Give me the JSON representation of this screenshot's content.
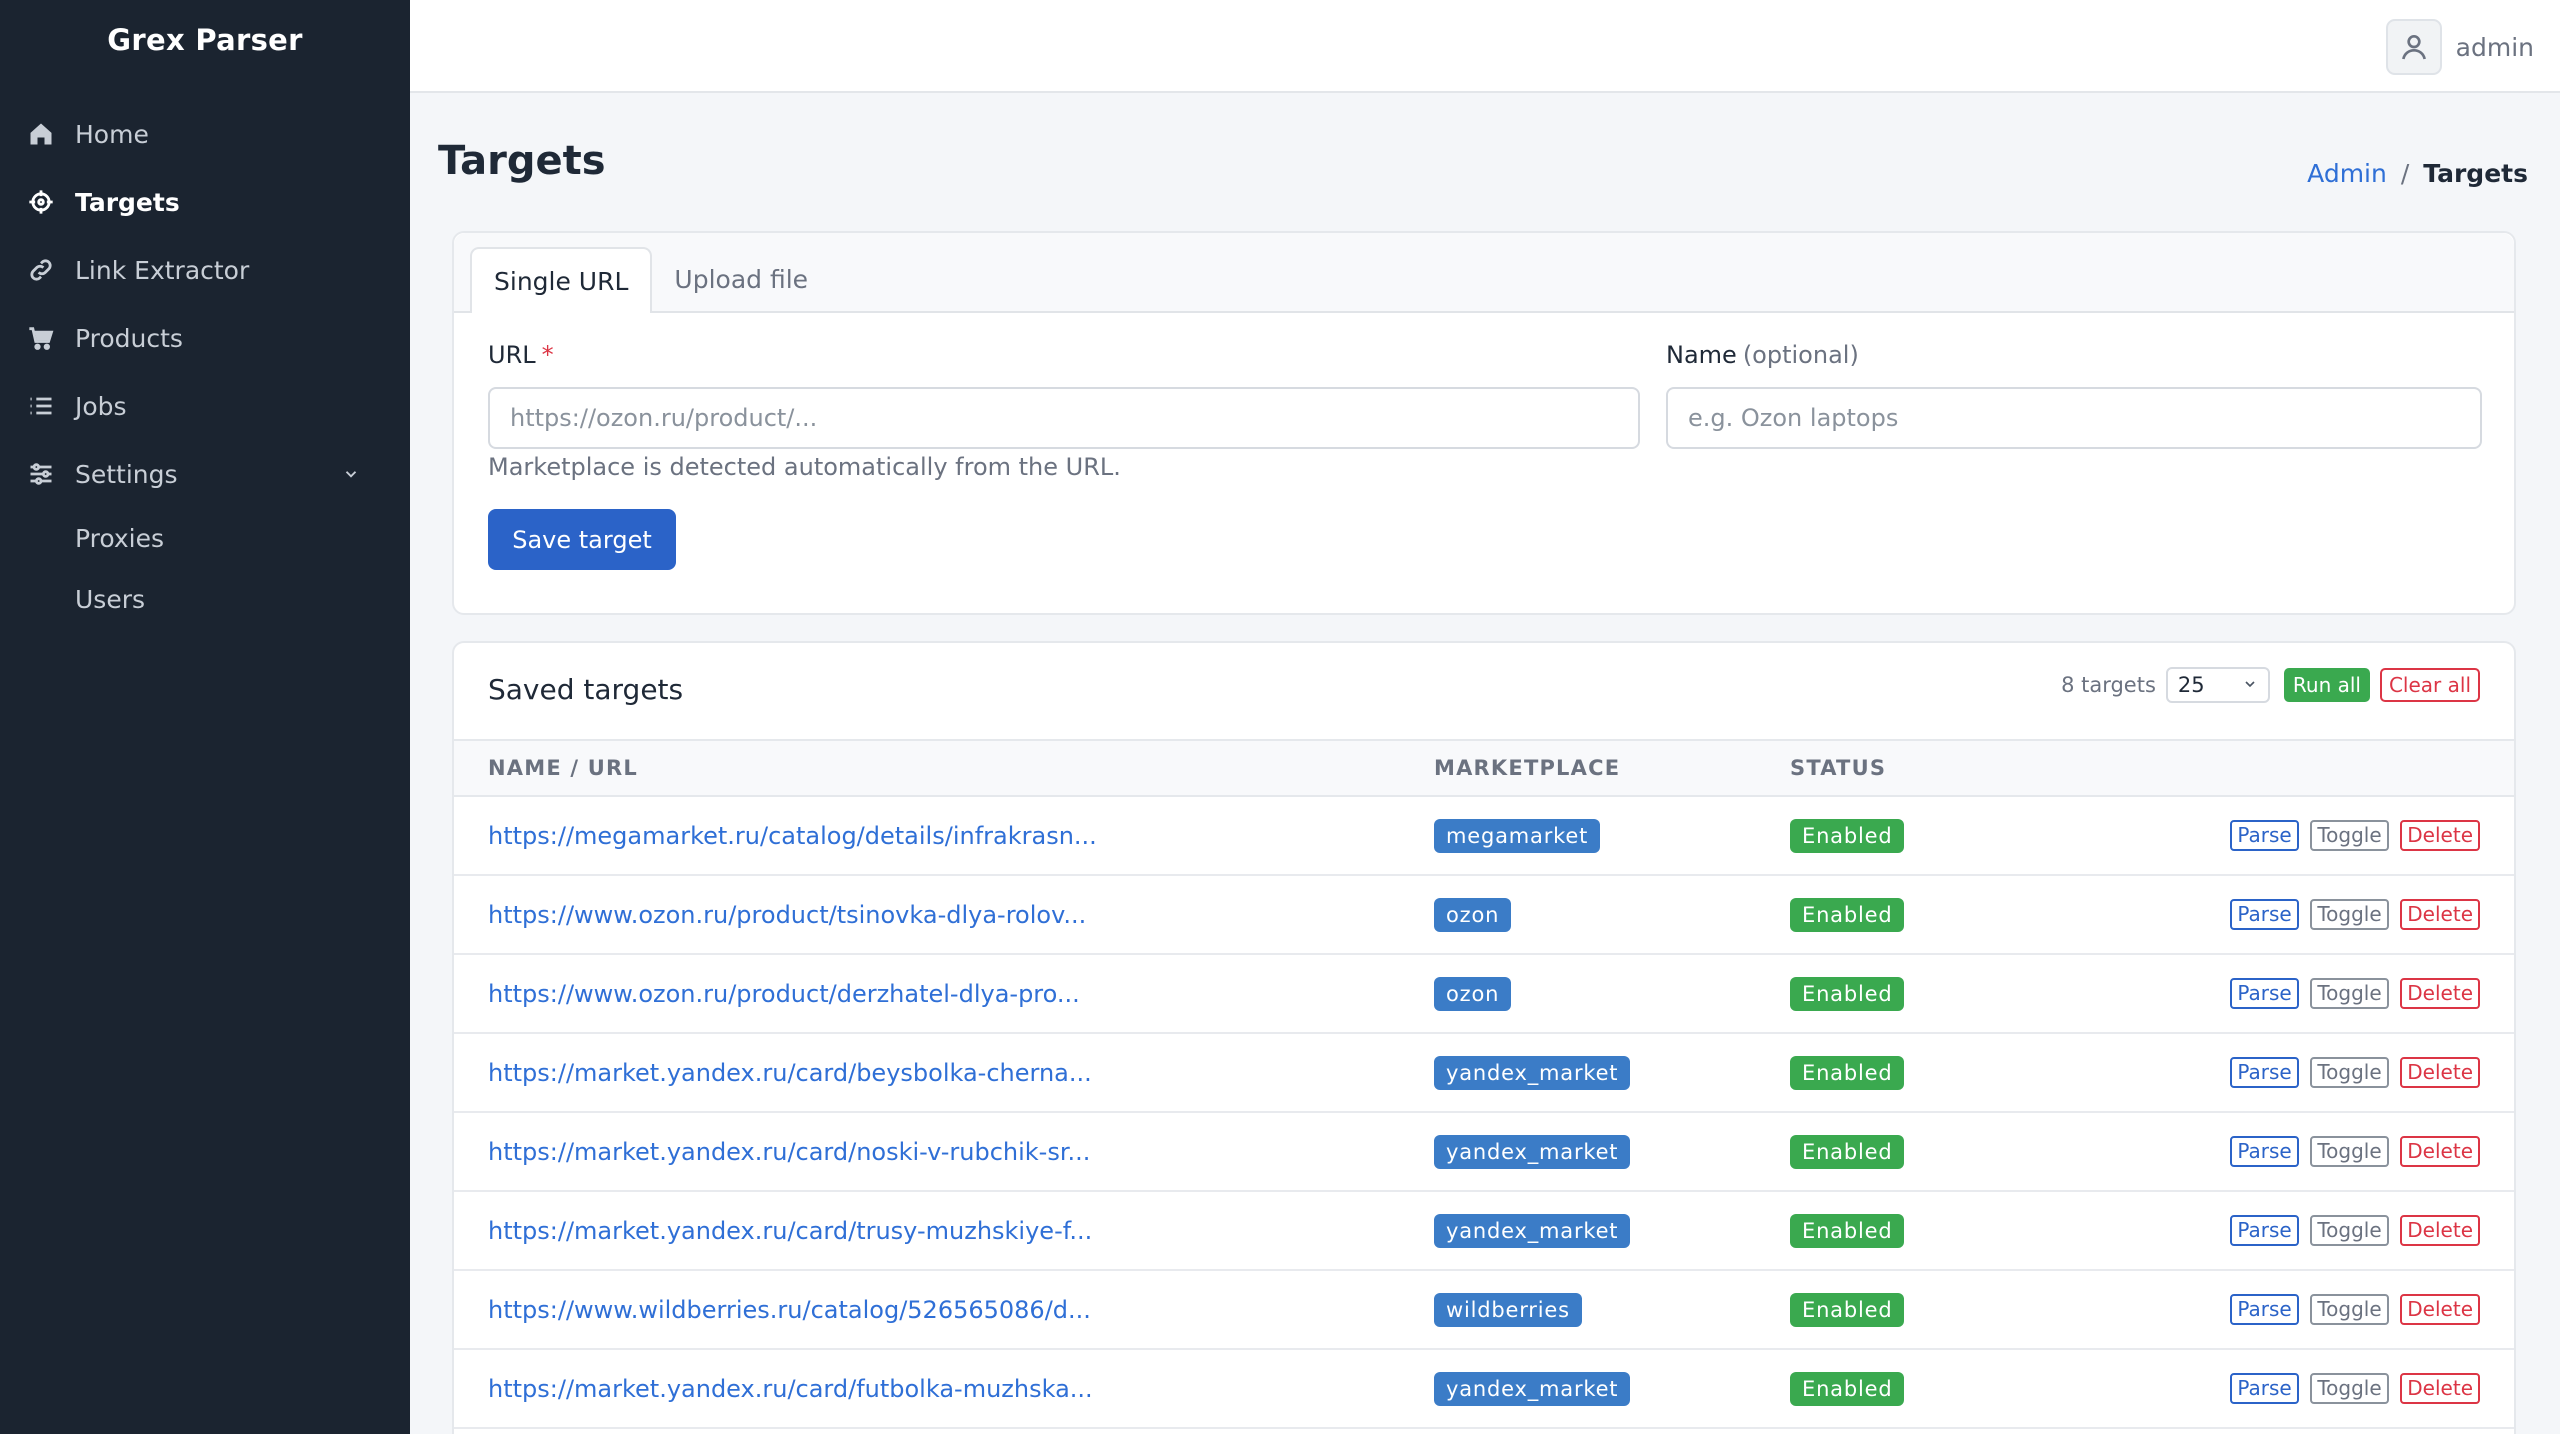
{
  "app": {
    "title": "Grex Parser"
  },
  "sidebar": {
    "items": [
      {
        "label": "Home",
        "icon": "home-icon"
      },
      {
        "label": "Targets",
        "icon": "crosshair-icon",
        "active": true
      },
      {
        "label": "Link Extractor",
        "icon": "link-icon"
      },
      {
        "label": "Products",
        "icon": "cart-icon"
      },
      {
        "label": "Jobs",
        "icon": "list-icon"
      },
      {
        "label": "Settings",
        "icon": "sliders-icon"
      }
    ],
    "settings_subitems": [
      "Proxies",
      "Users"
    ]
  },
  "topbar": {
    "user_name": "admin"
  },
  "page": {
    "title": "Targets",
    "breadcrumb": {
      "parent": "Admin",
      "separator": "/",
      "current": "Targets"
    }
  },
  "form": {
    "tabs": [
      "Single URL",
      "Upload file"
    ],
    "url_label": "URL",
    "url_required_mark": "*",
    "url_placeholder": "https://ozon.ru/product/...",
    "name_label": "Name",
    "name_optional": "(optional)",
    "name_placeholder": "e.g. Ozon laptops",
    "hint": "Marketplace is detected automatically from the URL.",
    "save_label": "Save target"
  },
  "targets": {
    "title": "Saved targets",
    "count_text": "8 targets",
    "page_size": "25",
    "run_all_label": "Run all",
    "clear_all_label": "Clear all",
    "columns": [
      "NAME / URL",
      "MARKETPLACE",
      "STATUS"
    ],
    "actions": {
      "parse": "Parse",
      "toggle": "Toggle",
      "delete": "Delete"
    },
    "rows": [
      {
        "url": "https://megamarket.ru/catalog/details/infrakrasn...",
        "marketplace": "megamarket",
        "status": "Enabled"
      },
      {
        "url": "https://www.ozon.ru/product/tsinovka-dlya-rolov...",
        "marketplace": "ozon",
        "status": "Enabled"
      },
      {
        "url": "https://www.ozon.ru/product/derzhatel-dlya-pro...",
        "marketplace": "ozon",
        "status": "Enabled"
      },
      {
        "url": "https://market.yandex.ru/card/beysbolka-cherna...",
        "marketplace": "yandex_market",
        "status": "Enabled"
      },
      {
        "url": "https://market.yandex.ru/card/noski-v-rubchik-sr...",
        "marketplace": "yandex_market",
        "status": "Enabled"
      },
      {
        "url": "https://market.yandex.ru/card/trusy-muzhskiye-f...",
        "marketplace": "yandex_market",
        "status": "Enabled"
      },
      {
        "url": "https://www.wildberries.ru/catalog/526565086/d...",
        "marketplace": "wildberries",
        "status": "Enabled"
      },
      {
        "url": "https://market.yandex.ru/card/futbolka-muzhska...",
        "marketplace": "yandex_market",
        "status": "Enabled"
      }
    ]
  },
  "colors": {
    "sidebar_bg": "#1b2430",
    "primary": "#2b63c8",
    "success": "#3aa94f",
    "danger": "#dc3545",
    "marketplace_badge": "#3b7cc7"
  }
}
